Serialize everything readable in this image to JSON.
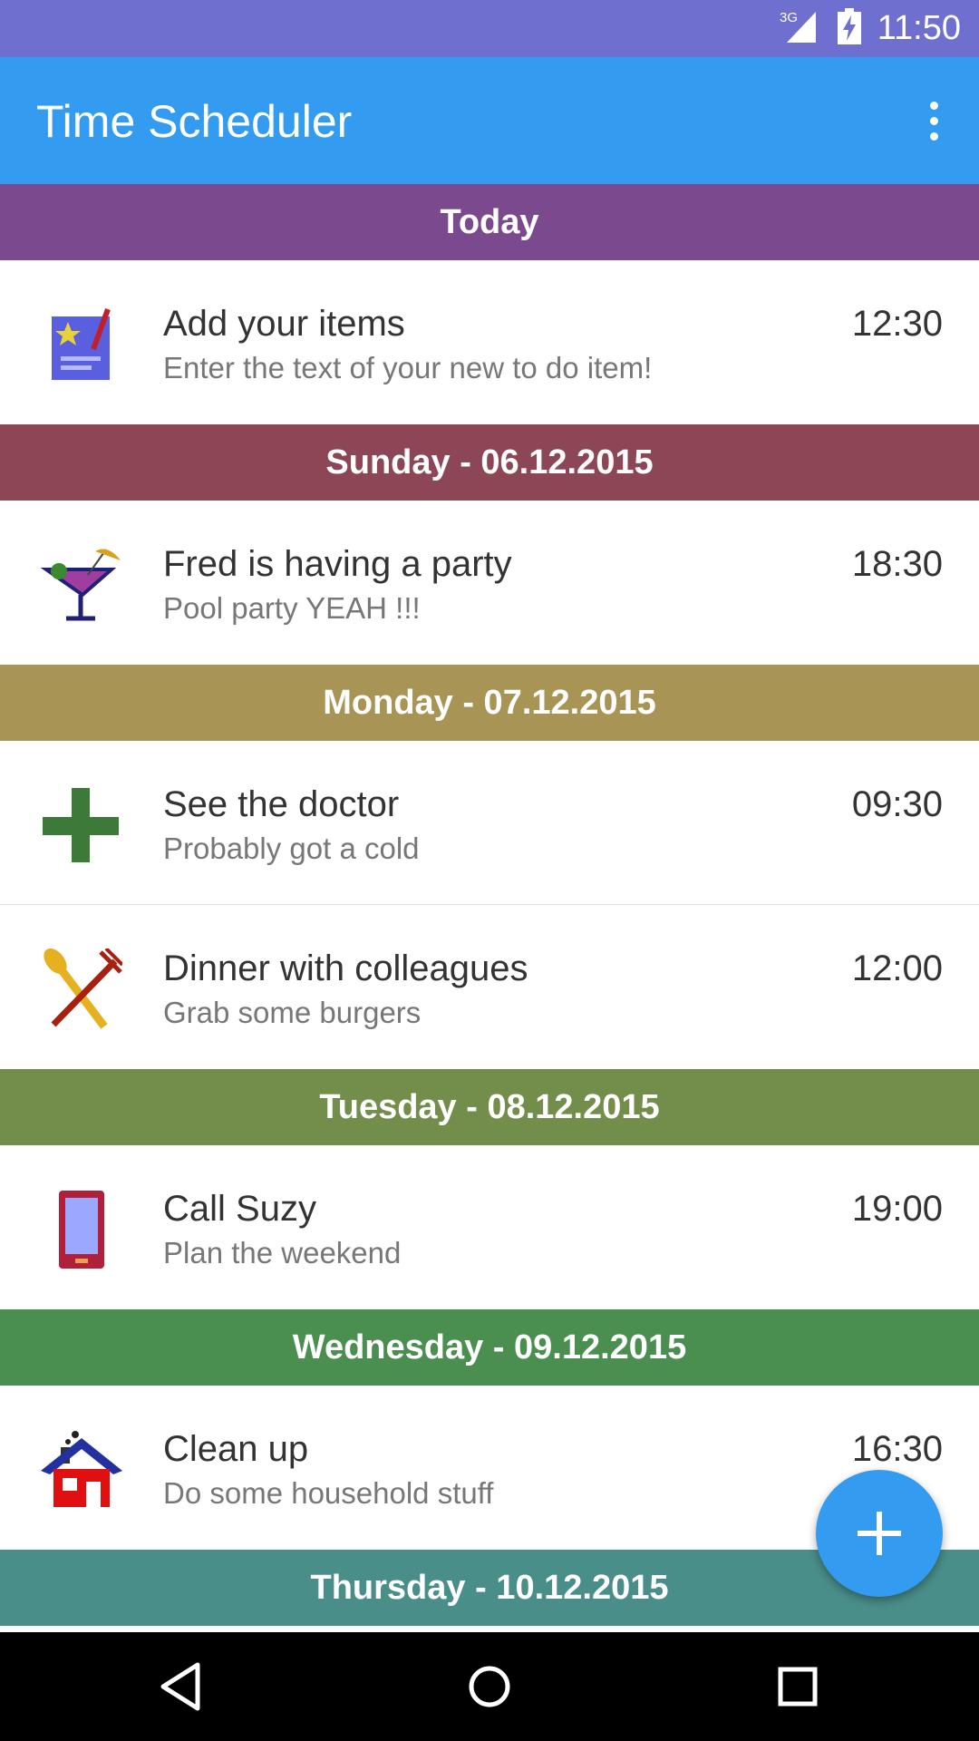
{
  "status_bar": {
    "network": "3G",
    "time": "11:50"
  },
  "app_bar": {
    "title": "Time Scheduler",
    "menu_icon": "more-vert-icon"
  },
  "sections": [
    {
      "header": "Today",
      "color": "#7b4a8e",
      "items": [
        {
          "icon": "notepad-icon",
          "title": "Add your items",
          "subtitle": "Enter the text of your new to do item!",
          "time": "12:30"
        }
      ]
    },
    {
      "header": "Sunday - 06.12.2015",
      "color": "#8d4656",
      "items": [
        {
          "icon": "cocktail-icon",
          "title": "Fred is having a party",
          "subtitle": "Pool party YEAH !!!",
          "time": "18:30"
        }
      ]
    },
    {
      "header": "Monday - 07.12.2015",
      "color": "#a89454",
      "items": [
        {
          "icon": "medical-cross-icon",
          "title": "See the doctor",
          "subtitle": "Probably got a cold",
          "time": "09:30"
        },
        {
          "icon": "fork-knife-icon",
          "title": "Dinner with colleagues",
          "subtitle": "Grab some burgers",
          "time": "12:00"
        }
      ]
    },
    {
      "header": "Tuesday - 08.12.2015",
      "color": "#738e4a",
      "items": [
        {
          "icon": "phone-icon",
          "title": "Call Suzy",
          "subtitle": "Plan the weekend",
          "time": "19:00"
        }
      ]
    },
    {
      "header": "Wednesday - 09.12.2015",
      "color": "#4a8e50",
      "items": [
        {
          "icon": "house-icon",
          "title": "Clean up",
          "subtitle": "Do some household stuff",
          "time": "16:30"
        }
      ]
    },
    {
      "header": "Thursday - 10.12.2015",
      "color": "#4a8e8a",
      "items": []
    }
  ],
  "fab": {
    "icon": "add-icon"
  },
  "nav_bar": {
    "back_icon": "back-icon",
    "home_icon": "home-icon",
    "recents_icon": "recents-icon"
  }
}
